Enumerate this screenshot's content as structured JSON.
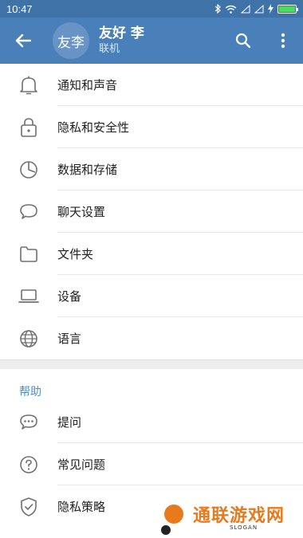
{
  "status_bar": {
    "time": "10:47"
  },
  "header": {
    "avatar_text": "友李",
    "name": "友好 李",
    "status": "联机"
  },
  "menu": {
    "items": [
      {
        "label": "通知和声音",
        "icon": "bell-icon"
      },
      {
        "label": "隐私和安全性",
        "icon": "lock-icon"
      },
      {
        "label": "数据和存储",
        "icon": "pie-chart-icon"
      },
      {
        "label": "聊天设置",
        "icon": "chat-bubble-icon"
      },
      {
        "label": "文件夹",
        "icon": "folder-icon"
      },
      {
        "label": "设备",
        "icon": "laptop-icon"
      },
      {
        "label": "语言",
        "icon": "globe-icon"
      }
    ]
  },
  "help": {
    "title": "帮助",
    "items": [
      {
        "label": "提问",
        "icon": "chat-dots-icon"
      },
      {
        "label": "常见问题",
        "icon": "question-circle-icon"
      },
      {
        "label": "隐私策略",
        "icon": "shield-check-icon"
      }
    ]
  },
  "watermark": {
    "text": "通联游戏网",
    "slogan": "SLOGAN"
  },
  "colors": {
    "app_bar": "#4a80b9",
    "status_bar": "#3f73a8",
    "accent": "#4a90d0",
    "watermark": "#e87a1e"
  }
}
